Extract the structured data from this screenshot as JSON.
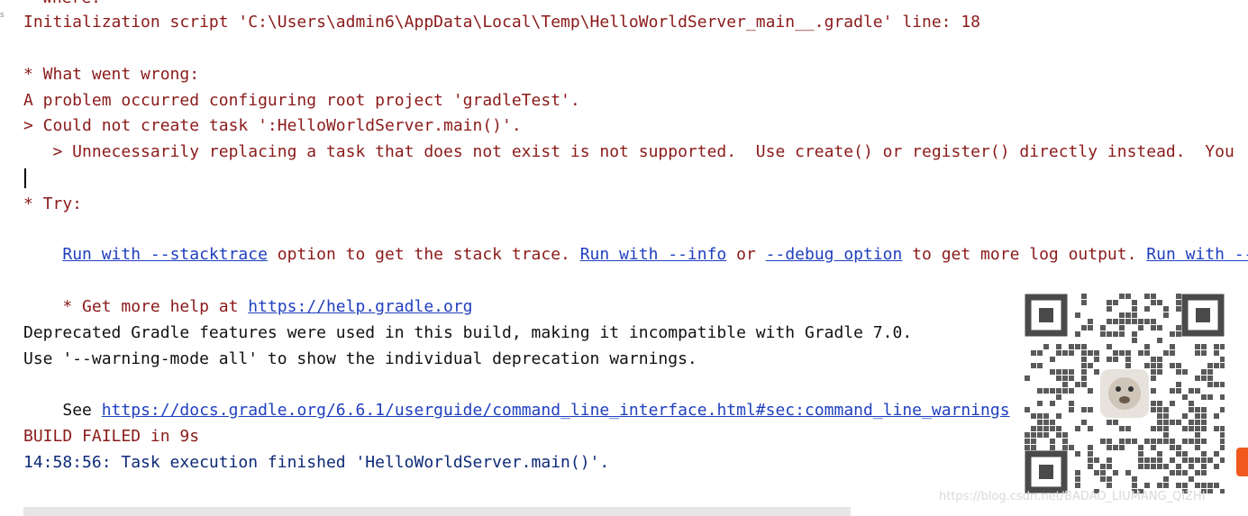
{
  "console": {
    "partial_top": "where:",
    "gutter_mark": "s",
    "init_script_line": "Initialization script 'C:\\Users\\admin6\\AppData\\Local\\Temp\\HelloWorldServer_main__.gradle' line: 18",
    "what_went_wrong": "* What went wrong:",
    "problem_line": "A problem occurred configuring root project 'gradleTest'.",
    "could_not_create": "> Could not create task ':HelloWorldServer.main()'.",
    "unnecessarily_line": "   > Unnecessarily replacing a task that does not exist is not supported.  Use create() or register() directly instead.  You",
    "try_header": "* Try:",
    "try": {
      "link_stacktrace": "Run with --stacktrace",
      "text_1": " option to get the stack trace. ",
      "link_info": "Run with --info",
      "text_2": " or ",
      "link_debug": "--debug option",
      "text_3": " to get more log output. ",
      "link_scan": "Run with --sc"
    },
    "help_prefix": "* Get more help at ",
    "help_link": "https://help.gradle.org",
    "deprecated_line": "Deprecated Gradle features were used in this build, making it incompatible with Gradle 7.0.",
    "warning_mode_line": "Use '--warning-mode all' to show the individual deprecation warnings.",
    "see_prefix": "See ",
    "see_link": "https://docs.gradle.org/6.6.1/userguide/command_line_interface.html#sec:command_line_warnings",
    "build_failed": "BUILD FAILED in 9s",
    "task_finished": "14:58:56: Task execution finished 'HelloWorldServer.main()'."
  },
  "watermark": {
    "text": "https://blog.csdn.net/BADAO_LIUMANG_QIZHI"
  },
  "colors": {
    "error_text": "#8b1a1a",
    "info_text": "#111111",
    "status_text": "#0d2a78",
    "link": "#1f3fbf",
    "brand_tab": "#f05a1e"
  },
  "icons": {
    "qr_code": "qr-code-image",
    "brand_tab": "csdn-brand-tab"
  }
}
